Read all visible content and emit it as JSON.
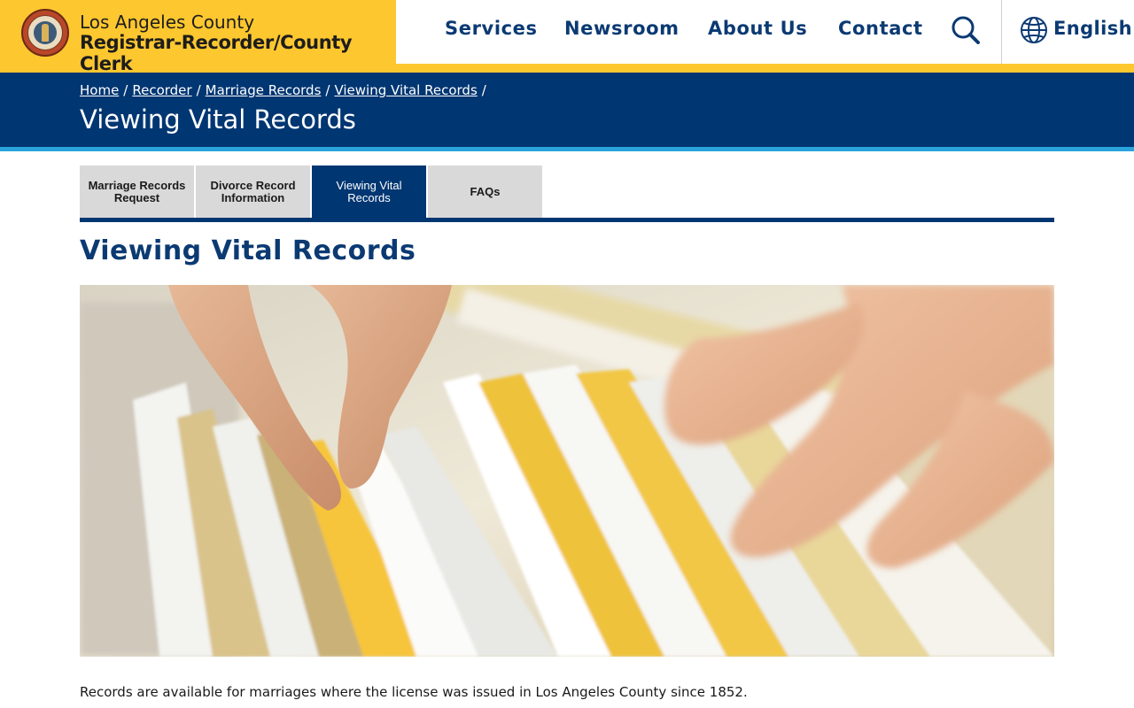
{
  "header": {
    "county": "Los Angeles County",
    "department": "Registrar-Recorder/County Clerk",
    "seal_icon": "county-seal",
    "nav": [
      {
        "label": "Services"
      },
      {
        "label": "Newsroom"
      },
      {
        "label": "About Us"
      },
      {
        "label": "Contact"
      }
    ],
    "search_icon": "search-icon",
    "language": {
      "icon": "globe-icon",
      "label": "English"
    },
    "colors": {
      "brand_gold": "#fdc72f",
      "nav_blue": "#0b3a73"
    }
  },
  "banner": {
    "breadcrumb": [
      {
        "label": "Home"
      },
      {
        "label": "Recorder"
      },
      {
        "label": "Marriage Records"
      },
      {
        "label": "Viewing Vital Records"
      }
    ],
    "separator": "/",
    "title": "Viewing Vital Records",
    "colors": {
      "background": "#003672",
      "accent": "#2aa3dc"
    }
  },
  "tabs": [
    {
      "label": "Marriage Records Request",
      "active": false
    },
    {
      "label": "Divorce Record Information",
      "active": false
    },
    {
      "label": "Viewing Vital Records",
      "active": true
    },
    {
      "label": "FAQs",
      "active": false
    }
  ],
  "main": {
    "heading": "Viewing Vital Records",
    "hero_image": "hands flipping through file folders",
    "paragraph": "Records are available for marriages where the license was issued in Los Angeles County since 1852."
  }
}
